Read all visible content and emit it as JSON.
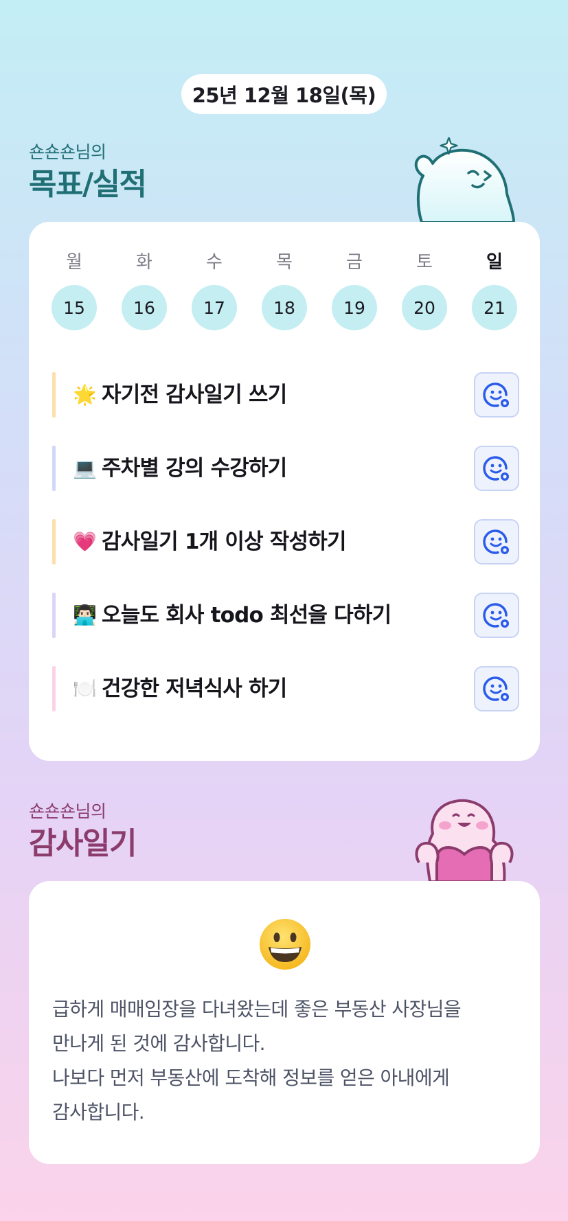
{
  "header": {
    "date": "25년 12월 18일(목)"
  },
  "goals_section": {
    "subtitle": "숀숀숀님의",
    "title": "목표/실적"
  },
  "week": {
    "days": [
      {
        "name": "월",
        "num": "15"
      },
      {
        "name": "화",
        "num": "16"
      },
      {
        "name": "수",
        "num": "17"
      },
      {
        "name": "목",
        "num": "18"
      },
      {
        "name": "금",
        "num": "19"
      },
      {
        "name": "토",
        "num": "20"
      },
      {
        "name": "일",
        "num": "21"
      }
    ]
  },
  "goals": [
    {
      "emoji": "🌟",
      "text": "자기전 감사일기 쓰기",
      "bar_color": "#fddfae",
      "icon": "smile-add-icon"
    },
    {
      "emoji": "💻",
      "text": "주차별 강의 수강하기",
      "bar_color": "#d2d8f8",
      "icon": "smile-add-icon"
    },
    {
      "emoji": "💗",
      "text": "감사일기 1개 이상 작성하기",
      "bar_color": "#fddfae",
      "icon": "smile-add-icon"
    },
    {
      "emoji": "👨🏻‍💻",
      "text": "오늘도 회사 todo 최선을 다하기",
      "bar_color": "#d9d6f8",
      "icon": "smile-add-icon"
    },
    {
      "emoji": "🍽️",
      "text": "건강한 저녁식사 하기",
      "bar_color": "#fcd3e6",
      "icon": "smile-add-icon"
    }
  ],
  "diary_section": {
    "subtitle": "숀숀숀님의",
    "title": "감사일기"
  },
  "diary": {
    "mood_icon": "grinning-face-icon",
    "lines": [
      "급하게 매매임장을 다녀왔는데 좋은 부동산 사장님을",
      "만나게 된 것에 감사합니다.",
      "나보다 먼저 부동산에 도착해 정보를 얻은 아내에게",
      "감사합니다."
    ]
  },
  "colors": {
    "teal_title": "#1f6f74",
    "plum_title": "#8c3b6d",
    "day_circle": "#c4eef2",
    "action_button": "#eef2fd"
  }
}
